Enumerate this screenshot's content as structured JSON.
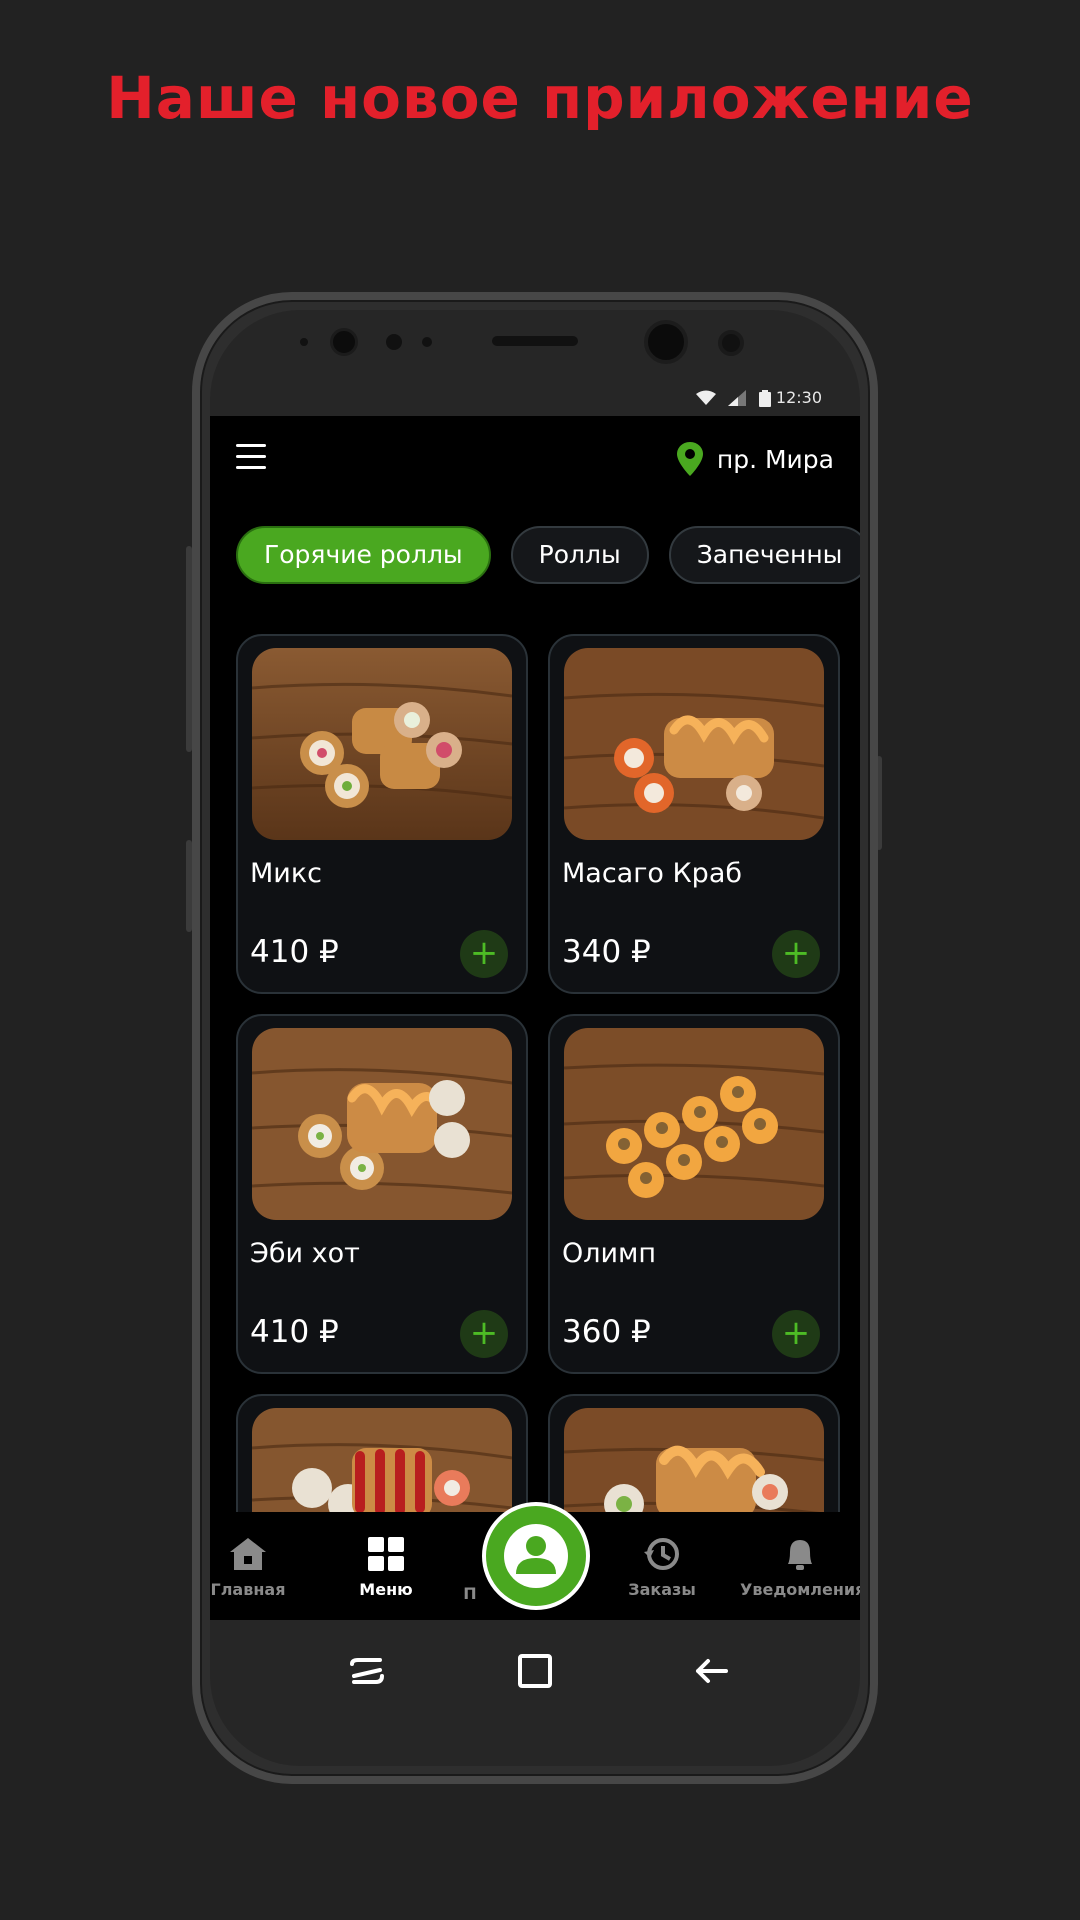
{
  "headline": "Наше новое приложение",
  "status_bar": {
    "time": "12:30",
    "icons": [
      "wifi-icon",
      "signal-icon",
      "battery-icon"
    ]
  },
  "header": {
    "location": "пр. Мира",
    "menu_icon": "hamburger-icon",
    "location_icon": "map-pin-icon"
  },
  "categories": [
    "Горячие роллы",
    "Роллы",
    "Запеченны"
  ],
  "active_category": "Горячие роллы",
  "products": [
    {
      "name": "Микс",
      "price": "410 ₽"
    },
    {
      "name": "Масаго Краб",
      "price": "340 ₽"
    },
    {
      "name": "Эби хот",
      "price": "410 ₽"
    },
    {
      "name": "Олимп",
      "price": "360 ₽"
    },
    {
      "name": "",
      "price": ""
    },
    {
      "name": "",
      "price": ""
    }
  ],
  "nav": {
    "items": [
      {
        "label": "Главная",
        "icon": "home-icon"
      },
      {
        "label": "Меню",
        "icon": "grid-icon"
      },
      {
        "label": "П",
        "icon": "profile-icon"
      },
      {
        "label": "Заказы",
        "icon": "history-icon"
      },
      {
        "label": "Уведомления",
        "icon": "bell-icon"
      }
    ],
    "active": "Меню"
  },
  "colors": {
    "accent": "#4aa820",
    "headline": "#e3202b",
    "background": "#222222",
    "screen": "#000000"
  }
}
